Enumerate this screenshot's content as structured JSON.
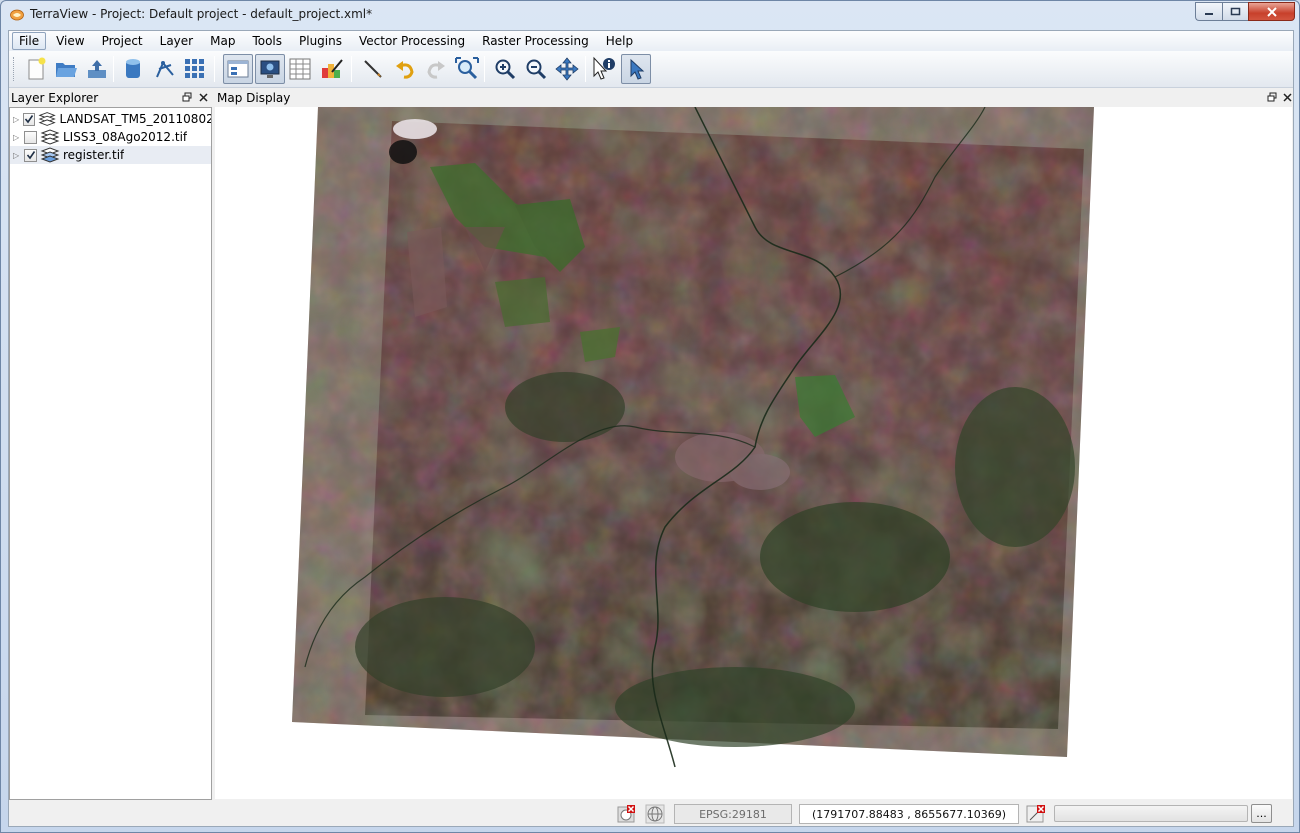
{
  "window": {
    "title": "TerraView - Project: Default project - default_project.xml*",
    "caption_min": "minimize-icon",
    "caption_max": "maximize-icon",
    "caption_close": "close-icon"
  },
  "menu": [
    "File",
    "View",
    "Project",
    "Layer",
    "Map",
    "Tools",
    "Plugins",
    "Vector Processing",
    "Raster Processing",
    "Help"
  ],
  "toolbar": {
    "icons": [
      "new-project-icon",
      "open-project-icon",
      "save-project-icon",
      "data-source-icon",
      "vector-tool-icon",
      "grid-icon",
      "layer-explorer-toggle-icon",
      "map-display-toggle-icon",
      "table-view-icon",
      "style-explorer-icon",
      "measure-icon",
      "undo-icon",
      "redo-icon",
      "zoom-extent-icon",
      "zoom-in-icon",
      "zoom-out-icon",
      "pan-icon",
      "info-icon",
      "select-pointer-icon"
    ]
  },
  "layer_explorer": {
    "title": "Layer Explorer",
    "layers": [
      {
        "label": "LANDSAT_TM5_20110802...",
        "checked": true
      },
      {
        "label": "LISS3_08Ago2012.tif",
        "checked": false
      },
      {
        "label": "register.tif",
        "checked": true
      }
    ]
  },
  "map_display": {
    "title": "Map Display"
  },
  "status": {
    "srid": "EPSG:29181",
    "coordinates": "(1791707.88483 , 8655677.10369)",
    "more_label": "...",
    "progress": 0
  },
  "colors": {
    "accent": "#3c6fb4",
    "map_dark": "#3a3a2c",
    "map_red": "#7a4a48",
    "map_green": "#3e5a2c"
  }
}
